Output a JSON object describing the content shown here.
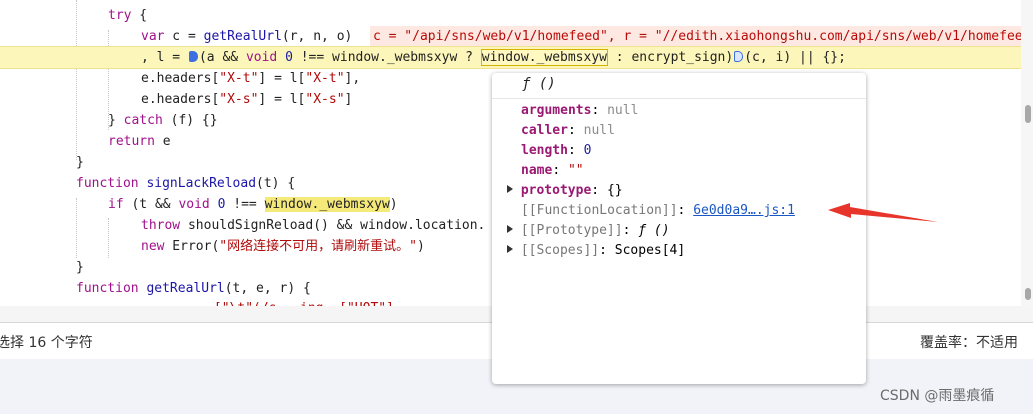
{
  "code": {
    "l1_kw": "try",
    "l1_rest": " {",
    "l2_kw": "var",
    "l2_a": " c = ",
    "l2_fn": "getRealUrl",
    "l2_b": "(r, n, o)",
    "l2_inline": "c = \"/api/sns/web/v1/homefeed\", r = \"//edith.xiaohongshu.com/api/sns/web/v1/homefee",
    "l3_a": ", l = ",
    "l3_b": "(a && ",
    "l3_void": "void",
    "l3_c": " ",
    "l3_zero": "0",
    "l3_d": " !== window._webmsxyw ? ",
    "l3_boxed": "window._webmsxyw",
    "l3_e": " : encrypt_sign)",
    "l3_f": "(c, i) || {};",
    "l4": "e.headers[",
    "l4_s1": "\"X-t\"",
    "l4_b": "] = l[",
    "l4_s2": "\"X-t\"",
    "l4_c": "],",
    "l5": "e.headers[",
    "l5_s1": "\"X-s\"",
    "l5_b": "] = l[",
    "l5_s2": "\"X-s\"",
    "l5_c": "]",
    "l6_a": "} ",
    "l6_kw": "catch",
    "l6_b": " (f) {}",
    "l7_kw": "return",
    "l7_b": " e",
    "l8": "}",
    "l9_kw": "function",
    "l9_fn": " signLackReload",
    "l9_b": "(t) {",
    "l10_kw": "if",
    "l10_a": " (t && ",
    "l10_void": "void",
    "l10_b": " ",
    "l10_zero": "0",
    "l10_c": " !== ",
    "l10_y": "window._webmsxyw",
    "l10_d": ")",
    "l11_kw": "throw",
    "l11_b": " shouldSignReload() && window.location.",
    "l12_kw": "new",
    "l12_b": " Error(",
    "l12_str": "\"网络连接不可用，请刷新重试。\"",
    "l12_c": ")",
    "l13": "}",
    "l14_kw": "function",
    "l14_fn": " getRealUrl",
    "l14_b": "(t, e, r) {",
    "l15": "            [\"\\t\"(/s, .ing, [\"HOT\"]"
  },
  "status": {
    "selection": "选择 16 个字符",
    "coverage": "覆盖率：不适用"
  },
  "popup": {
    "header": "ƒ ()",
    "rows": [
      {
        "key": "arguments",
        "sep": ": ",
        "value": "null"
      },
      {
        "key": "caller",
        "sep": ": ",
        "value": "null"
      },
      {
        "key": "length",
        "sep": ": ",
        "value": "0"
      },
      {
        "key": "name",
        "sep": ": ",
        "value": "\"\""
      },
      {
        "key": "prototype",
        "sep": ": ",
        "value": "{}"
      }
    ],
    "function_location_key": "[[FunctionLocation]]",
    "function_location_link": "6e0d0a9….js:1",
    "proto_key": "[[Prototype]]",
    "proto_value": "ƒ ()",
    "scopes_key": "[[Scopes]]",
    "scopes_value": "Scopes[4]"
  },
  "watermark": "CSDN @雨墨痕循",
  "colors": {
    "arrow": "#e8352b",
    "link": "#1a56c4",
    "highlight": "#fdf6ba"
  },
  "icons": {
    "breakpoint": "breakpoint-marker-icon",
    "arrow": "annotation-arrow-icon",
    "expand": "expand-triangle-icon"
  }
}
